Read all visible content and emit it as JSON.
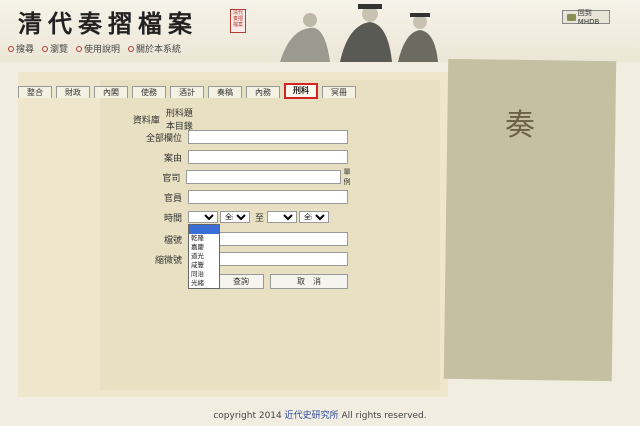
{
  "header": {
    "title": "清代奏摺檔案",
    "seal_text": "清代奏摺檔案",
    "nav": [
      "搜尋",
      "瀏覽",
      "使用說明",
      "關於本系統"
    ],
    "back_button": "回到MHDB"
  },
  "side_label": "奏",
  "tabs": [
    "整合",
    "財政",
    "內閣",
    "使務",
    "酒計",
    "奏稿",
    "內務",
    "刑科",
    "冥冊"
  ],
  "form": {
    "database_label": "資料庫",
    "database_value": "刑科題本目錄",
    "fields": [
      {
        "label": "全部欄位",
        "value": ""
      },
      {
        "label": "案由",
        "value": ""
      },
      {
        "label": "官司",
        "value": "",
        "note": "單例"
      },
      {
        "label": "官員",
        "value": ""
      }
    ],
    "time_label": "時間",
    "time_reign_value": "",
    "time_year_value": "全部",
    "time_to": "至",
    "time_reign2_value": "",
    "time_year2_value": "全部",
    "reign_options": [
      "",
      "乾隆",
      "嘉慶",
      "道光",
      "咸豐",
      "同治",
      "光緒"
    ],
    "extra_fields": [
      {
        "label": "檔號",
        "value": ""
      },
      {
        "label": "縮微號",
        "value": ""
      }
    ],
    "query_button": "查詢",
    "cancel_button": "取　消"
  },
  "footer": {
    "prefix": "copyright 2014",
    "link": "近代史研究所",
    "suffix": "All rights reserved."
  }
}
